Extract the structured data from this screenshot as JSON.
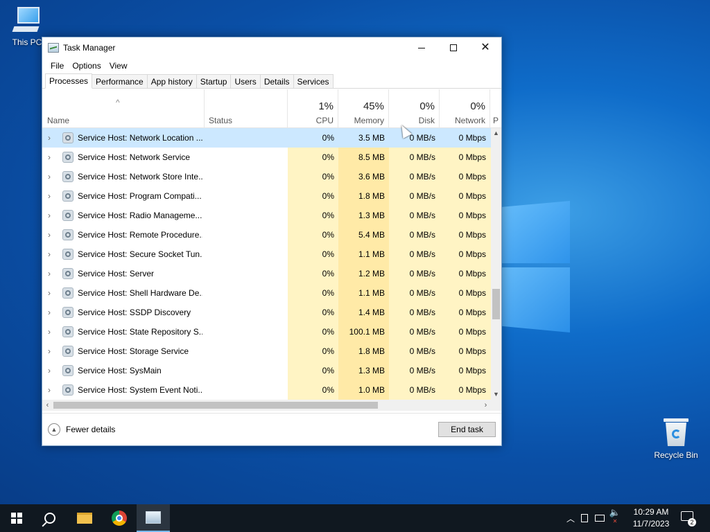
{
  "desktop": {
    "icons": [
      {
        "label": "This PC"
      },
      {
        "label": "Recycle Bin"
      }
    ]
  },
  "window": {
    "title": "Task Manager",
    "menu": [
      "File",
      "Options",
      "View"
    ],
    "tabs": [
      "Processes",
      "Performance",
      "App history",
      "Startup",
      "Users",
      "Details",
      "Services"
    ],
    "active_tab": "Processes"
  },
  "table": {
    "sort_indicator": "^",
    "columns": {
      "name": "Name",
      "status": "Status",
      "cpu": {
        "pct": "1%",
        "label": "CPU"
      },
      "memory": {
        "pct": "45%",
        "label": "Memory"
      },
      "disk": {
        "pct": "0%",
        "label": "Disk"
      },
      "network": {
        "pct": "0%",
        "label": "Network"
      },
      "power": "P"
    },
    "rows": [
      {
        "name": "Service Host: Network Location ...",
        "status": "",
        "cpu": "0%",
        "memory": "3.5 MB",
        "disk": "0 MB/s",
        "network": "0 Mbps"
      },
      {
        "name": "Service Host: Network Service",
        "status": "",
        "cpu": "0%",
        "memory": "8.5 MB",
        "disk": "0 MB/s",
        "network": "0 Mbps"
      },
      {
        "name": "Service Host: Network Store Inte...",
        "status": "",
        "cpu": "0%",
        "memory": "3.6 MB",
        "disk": "0 MB/s",
        "network": "0 Mbps"
      },
      {
        "name": "Service Host: Program Compati...",
        "status": "",
        "cpu": "0%",
        "memory": "1.8 MB",
        "disk": "0 MB/s",
        "network": "0 Mbps"
      },
      {
        "name": "Service Host: Radio Manageme...",
        "status": "",
        "cpu": "0%",
        "memory": "1.3 MB",
        "disk": "0 MB/s",
        "network": "0 Mbps"
      },
      {
        "name": "Service Host: Remote Procedure...",
        "status": "",
        "cpu": "0%",
        "memory": "5.4 MB",
        "disk": "0 MB/s",
        "network": "0 Mbps"
      },
      {
        "name": "Service Host: Secure Socket Tun...",
        "status": "",
        "cpu": "0%",
        "memory": "1.1 MB",
        "disk": "0 MB/s",
        "network": "0 Mbps"
      },
      {
        "name": "Service Host: Server",
        "status": "",
        "cpu": "0%",
        "memory": "1.2 MB",
        "disk": "0 MB/s",
        "network": "0 Mbps"
      },
      {
        "name": "Service Host: Shell Hardware De...",
        "status": "",
        "cpu": "0%",
        "memory": "1.1 MB",
        "disk": "0 MB/s",
        "network": "0 Mbps"
      },
      {
        "name": "Service Host: SSDP Discovery",
        "status": "",
        "cpu": "0%",
        "memory": "1.4 MB",
        "disk": "0 MB/s",
        "network": "0 Mbps"
      },
      {
        "name": "Service Host: State Repository S...",
        "status": "",
        "cpu": "0%",
        "memory": "100.1 MB",
        "disk": "0 MB/s",
        "network": "0 Mbps"
      },
      {
        "name": "Service Host: Storage Service",
        "status": "",
        "cpu": "0%",
        "memory": "1.8 MB",
        "disk": "0 MB/s",
        "network": "0 Mbps"
      },
      {
        "name": "Service Host: SysMain",
        "status": "",
        "cpu": "0%",
        "memory": "1.3 MB",
        "disk": "0 MB/s",
        "network": "0 Mbps"
      },
      {
        "name": "Service Host: System Event Noti...",
        "status": "",
        "cpu": "0%",
        "memory": "1.0 MB",
        "disk": "0 MB/s",
        "network": "0 Mbps"
      }
    ],
    "selected_row": 0
  },
  "footer": {
    "fewer_details": "Fewer details",
    "end_task": "End task"
  },
  "taskbar": {
    "apps": [
      "start-icon",
      "search-icon",
      "file-explorer-icon",
      "chrome-icon",
      "task-manager-icon"
    ],
    "clock_time": "10:29 AM",
    "clock_date": "11/7/2023",
    "notification_count": "2"
  },
  "colors": {
    "selected_row": "#cce8ff",
    "cpu_heat": "#fff4c4",
    "memory_heat": "#ffeaa7",
    "disk_heat": "#fff4c4",
    "network_heat": "#fff4c4"
  }
}
